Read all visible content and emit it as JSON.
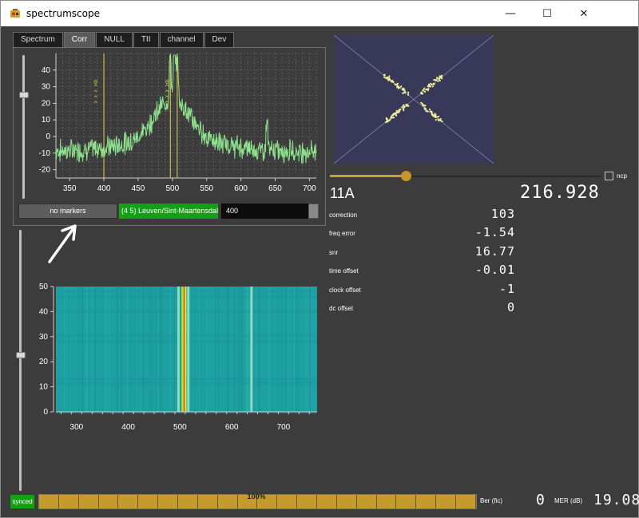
{
  "window": {
    "title": "spectrumscope",
    "minimize": "—",
    "maximize": "☐",
    "close": "✕"
  },
  "tabs": [
    "Spectrum",
    "Corr",
    "NULL",
    "TII",
    "channel",
    "Dev"
  ],
  "active_tab": "Corr",
  "controls": {
    "marker_button": "no markers",
    "station": "(4 5) Leuven/Sint-Maartensdal",
    "number_field": "400",
    "ncp_label": "ncp",
    "ncp_checked": false,
    "slider_level": 0.28,
    "upper_vslider_level": 0.72,
    "left_vslider_level": 0.52
  },
  "status": {
    "channel": "11A",
    "frequency": "216.928",
    "stats": [
      {
        "label": "correction",
        "value": "103"
      },
      {
        "label": "freq error",
        "value": "-1.54"
      },
      {
        "label": "snr",
        "value": "16.77"
      },
      {
        "label": "time offset",
        "value": "-0.01"
      },
      {
        "label": "clock offset",
        "value": "-1"
      },
      {
        "label": "dc offset",
        "value": "0"
      }
    ]
  },
  "bottom": {
    "synced": "synced",
    "fic_quality": "100%",
    "fic_level": 1.0,
    "ber_label": "Ber (fic)",
    "ber_value": "0",
    "mer_label": "MER (dB)",
    "mer_value": "19.08"
  },
  "colors": {
    "background": "#3c3c3c",
    "spectrum_line": "#8ee28e",
    "marker_line": "#e6d24a",
    "constellation_bg": "#383858",
    "constellation_point": "#f0f096",
    "synced": "#14a014",
    "fic_bar": "#c69b2d"
  },
  "chart_data": [
    {
      "type": "line",
      "name_hint": "correlation spectrum",
      "xlim": [
        330,
        710
      ],
      "ylim": [
        -25,
        50
      ],
      "x_ticks": [
        350,
        400,
        450,
        500,
        550,
        600,
        650,
        700
      ],
      "y_ticks": [
        -20,
        -10,
        0,
        10,
        20,
        30,
        40
      ],
      "grid": true,
      "markers": [
        400,
        497,
        507
      ],
      "peaks": [
        {
          "x": 497,
          "y": 25
        },
        {
          "x": 503,
          "y": 43
        },
        {
          "x": 507,
          "y": 28
        },
        {
          "x": 638,
          "y": 10
        }
      ],
      "baseline": -12,
      "shoulder_peak": 5
    },
    {
      "type": "heatmap",
      "name_hint": "waterfall",
      "xlim": [
        260,
        765
      ],
      "ylim": [
        0,
        50
      ],
      "x_ticks": [
        300,
        400,
        500,
        600,
        700
      ],
      "y_ticks": [
        0,
        10,
        20,
        30,
        40,
        50
      ],
      "hot_lines": [
        505,
        510
      ],
      "bright_lines": [
        497,
        516,
        638
      ],
      "base_color": "#1ea0a0"
    },
    {
      "type": "scatter",
      "name_hint": "constellation",
      "arms": 4,
      "radius": 0.35
    }
  ]
}
